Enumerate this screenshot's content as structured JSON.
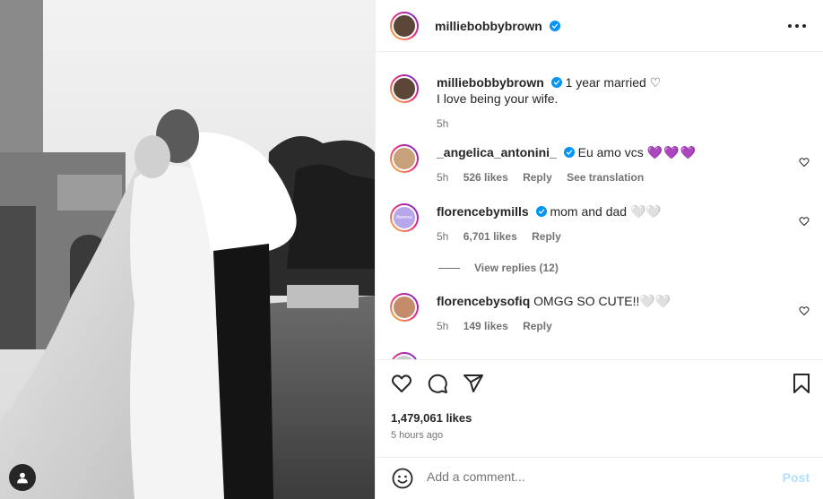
{
  "post": {
    "author": "milliebobbybrown",
    "photo_alt": "Wedding photo"
  },
  "caption": {
    "username": "milliebobbybrown",
    "line1": "1 year married ♡",
    "line2": "I love being your wife.",
    "time": "5h"
  },
  "comments": [
    {
      "username": "_angelica_antonini_",
      "verified": true,
      "text": "Eu amo vcs",
      "hearts": "💜💜💜",
      "time": "5h",
      "likes": "526 likes",
      "reply": "Reply",
      "extra": "See translation",
      "avatar_color": "#c7a07c"
    },
    {
      "username": "florencebymills",
      "verified": true,
      "text": "mom and dad 🤍🤍",
      "time": "5h",
      "likes": "6,701 likes",
      "reply": "Reply",
      "avatar_color": "#b8a6ea",
      "avatar_text": "florence"
    },
    {
      "username": "florencebysofiq",
      "verified": false,
      "text": "OMGG SO CUTE!!🤍🤍",
      "time": "5h",
      "likes": "149 likes",
      "reply": "Reply",
      "avatar_color": "#c48c6a"
    }
  ],
  "view_replies": "View replies (12)",
  "icons": {
    "like": "heart-icon",
    "comment": "comment-icon",
    "share": "send-icon",
    "save": "bookmark-icon",
    "more": "more-icon",
    "emoji": "emoji-icon",
    "verified": "verified-icon",
    "user_tag": "user-icon"
  },
  "stats": {
    "likes": "1,479,061 likes",
    "time": "5 hours ago"
  },
  "composer": {
    "placeholder": "Add a comment...",
    "post_label": "Post"
  },
  "colors": {
    "verified": "#0095f6",
    "post_disabled": "#b2dffc",
    "muted": "#737373"
  }
}
